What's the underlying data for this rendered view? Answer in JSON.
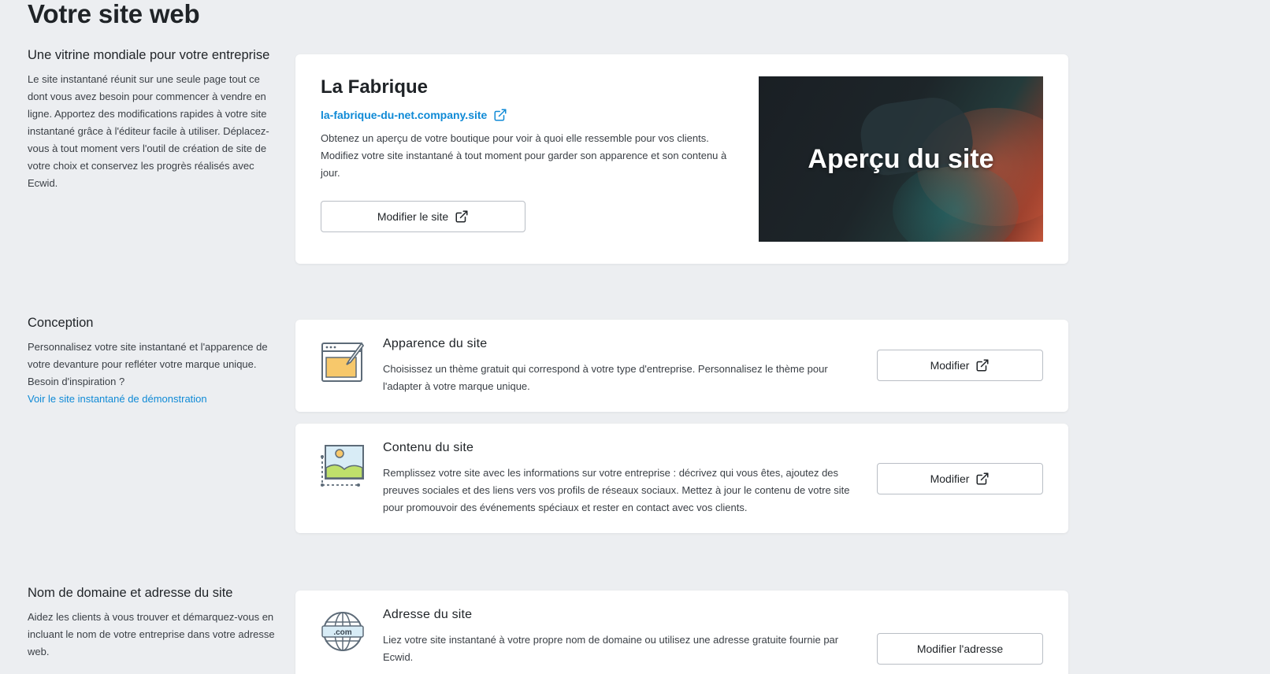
{
  "page": {
    "title": "Votre site web"
  },
  "section1": {
    "heading": "Une vitrine mondiale pour votre entreprise",
    "text": "Le site instantané réunit sur une seule page tout ce dont vous avez besoin pour commencer à vendre en ligne. Apportez des modifications rapides à votre site instantané grâce à l'éditeur facile à utiliser. Déplacez-vous à tout moment vers l'outil de création de site de votre choix et conservez les progrès réalisés avec Ecwid.",
    "card": {
      "store_name": "La Fabrique",
      "store_url": "la-fabrique-du-net.company.site",
      "description": "Obtenez un aperçu de votre boutique pour voir à quoi elle ressemble pour vos clients. Modifiez votre site instantané à tout moment pour garder son apparence et son contenu à jour.",
      "button": "Modifier le site",
      "preview_label": "Aperçu du site"
    }
  },
  "section2": {
    "heading": "Conception",
    "text": "Personnalisez votre site instantané et l'apparence de votre devanture pour refléter votre marque unique. Besoin d'inspiration ?",
    "link": "Voir le site instantané de démonstration",
    "items": [
      {
        "title": "Apparence du site",
        "description": "Choisissez un thème gratuit qui correspond à votre type d'entreprise. Personnalisez le thème pour l'adapter à votre marque unique.",
        "button": "Modifier",
        "icon": "design-window-icon"
      },
      {
        "title": "Contenu du site",
        "description": "Remplissez votre site avec les informations sur votre entreprise : décrivez qui vous êtes, ajoutez des preuves sociales et des liens vers vos profils de réseaux sociaux. Mettez à jour le contenu de votre site pour promouvoir des événements spéciaux et rester en contact avec vos clients.",
        "button": "Modifier",
        "icon": "image-content-icon"
      }
    ]
  },
  "section3": {
    "heading": "Nom de domaine et adresse du site",
    "text": "Aidez les clients à vous trouver et démarquez-vous en incluant le nom de votre entreprise dans votre adresse web.",
    "item": {
      "title": "Adresse du site",
      "description": "Liez votre site instantané à votre propre nom de domaine ou utilisez une adresse gratuite fournie par Ecwid.",
      "button": "Modifier l'adresse",
      "icon_text": ".com",
      "icon": "globe-domain-icon"
    }
  },
  "colors": {
    "link": "#0f8ad6",
    "background": "#eceef1",
    "card": "#ffffff"
  }
}
